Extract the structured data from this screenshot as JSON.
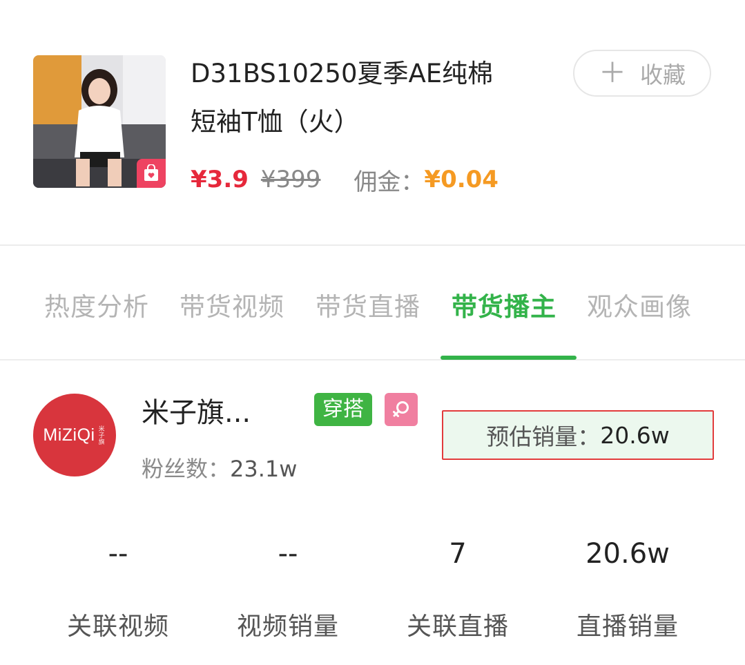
{
  "product": {
    "title_line1": "D31BS10250夏季AE纯棉",
    "title_line2": "短袖T恤（火）",
    "price_current": "¥3.9",
    "price_original": "¥399",
    "commission_label": "佣金：",
    "commission_value": "¥0.04",
    "thumb_badge_icon": "shop-bag-icon",
    "collect_icon": "plus-icon",
    "collect_label": "收藏"
  },
  "tabs": [
    {
      "label": "热度分析",
      "active": false
    },
    {
      "label": "带货视频",
      "active": false
    },
    {
      "label": "带货直播",
      "active": false
    },
    {
      "label": "带货播主",
      "active": true
    },
    {
      "label": "观众画像",
      "active": false
    }
  ],
  "anchor": {
    "logo_text": "MiZiQi",
    "logo_subtext": "米子旗",
    "name": "米子旗...",
    "category_tag": "穿搭",
    "gender_icon": "female-icon",
    "fans_label": "粉丝数：",
    "fans_value": "23.1w",
    "sales_label": "预估销量：",
    "sales_value": "20.6w"
  },
  "stats": [
    {
      "value": "--",
      "label": "关联视频"
    },
    {
      "value": "--",
      "label": "视频销量"
    },
    {
      "value": "7",
      "label": "关联直播"
    },
    {
      "value": "20.6w",
      "label": "直播销量"
    }
  ],
  "colors": {
    "accent_green": "#33b34a",
    "price_red": "#e6283b",
    "commission_orange": "#f59a23",
    "highlight_border": "#e23b3b",
    "brand_red": "#d8353d"
  }
}
